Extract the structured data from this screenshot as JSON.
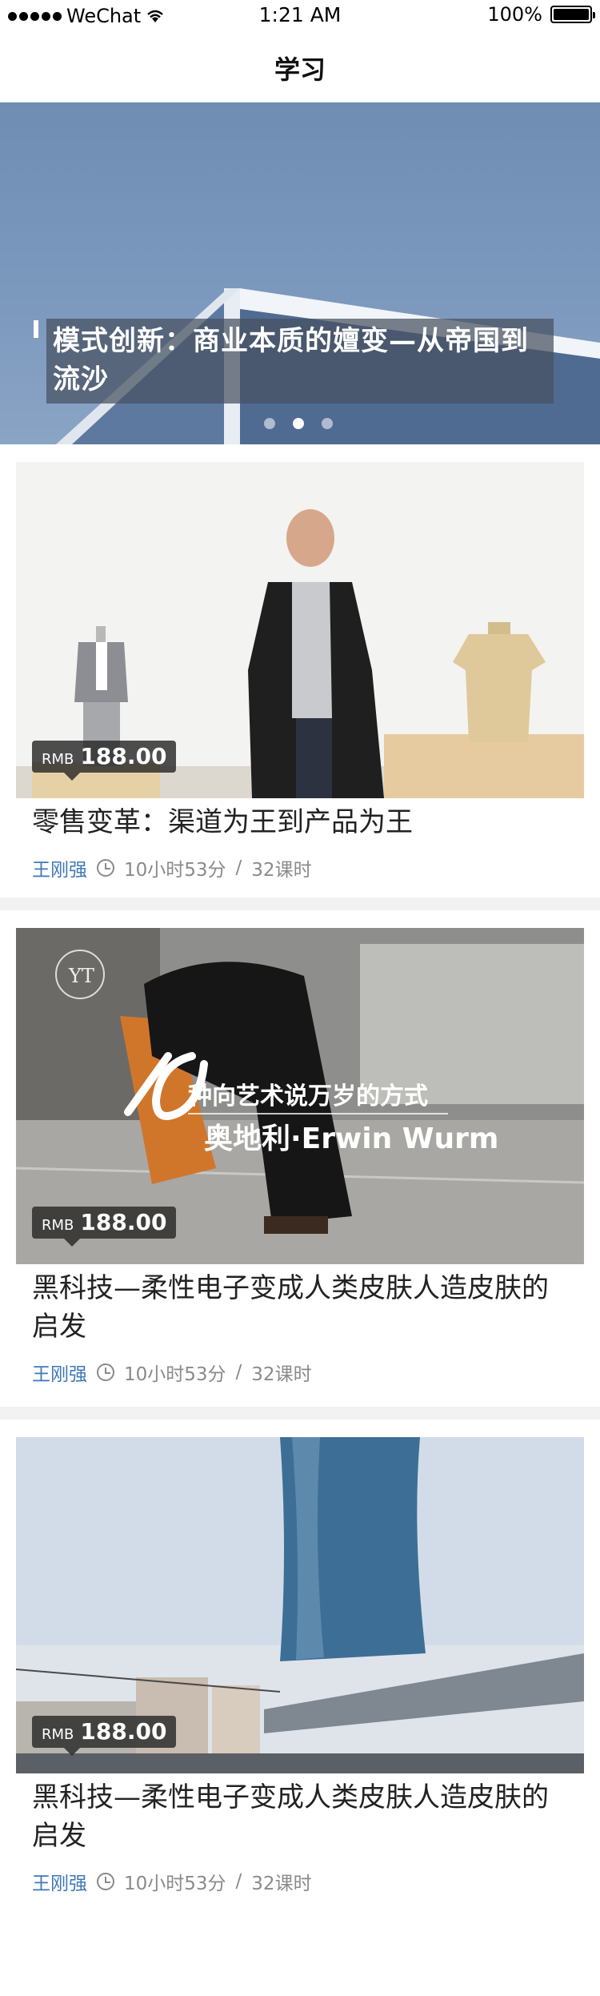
{
  "status_bar": {
    "carrier": "WeChat",
    "time": "1:21 AM",
    "battery": "100%"
  },
  "nav": {
    "title": "学习"
  },
  "banner": {
    "title": "模式创新：商业本质的嬗变—从帝国到流沙",
    "pages": 3,
    "active_page": 2
  },
  "courses": [
    {
      "price_currency": "RMB",
      "price": "188.00",
      "title": "零售变革：渠道为王到产品为王",
      "author": "王刚强",
      "duration": "10小时53分",
      "lessons": "32课时",
      "divider": "/"
    },
    {
      "price_currency": "RMB",
      "price": "188.00",
      "title": "黑科技—柔性电子变成人类皮肤人造皮肤的启发",
      "author": "王刚强",
      "duration": "10小时53分",
      "lessons": "32课时",
      "divider": "/",
      "overlay_line1": "种向艺术说万岁的方式",
      "overlay_line2": "奥地利·Erwin Wurm",
      "overlay_logo": "YT"
    },
    {
      "price_currency": "RMB",
      "price": "188.00",
      "title": "黑科技—柔性电子变成人类皮肤人造皮肤的启发",
      "author": "王刚强",
      "duration": "10小时53分",
      "lessons": "32课时",
      "divider": "/"
    }
  ],
  "colors": {
    "author_blue": "#3f79b6",
    "meta_gray": "#8a8a8a",
    "banner_blue": "#7b98bd"
  }
}
